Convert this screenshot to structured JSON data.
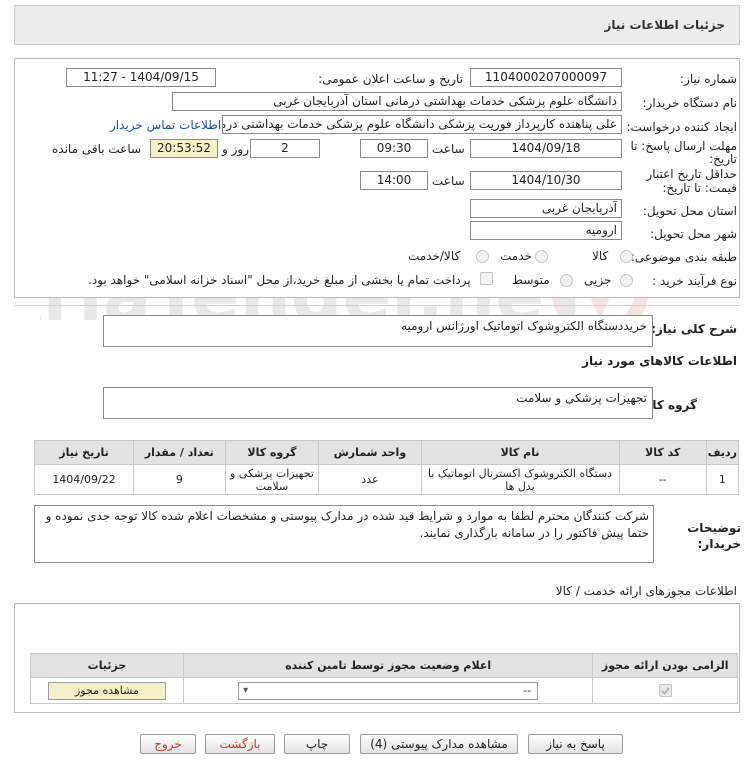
{
  "header": {
    "title": "جزئیات اطلاعات نیاز"
  },
  "fields": {
    "need_number_label": "شماره نیاز:",
    "need_number": "1104000207000097",
    "announce_label": "تاریخ و ساعت اعلان عمومی:",
    "announce_value": "1404/09/15 - 11:27",
    "buyer_org_label": "نام دستگاه خریدار:",
    "buyer_org": "دانشگاه علوم پزشکی خدمات بهداشتی درمانی استان آذربایجان غربی",
    "requester_label": "ایجاد کننده درخواست:",
    "requester": "علی پناهنده کارپرداز فوریت پزشکی دانشگاه علوم پزشکی خدمات بهداشتی درمانی استان آذربایجان غربی",
    "contact_link": "اطلاعات تماس خریدار",
    "deadline_label_1": "مهلت ارسال پاسخ: تا",
    "deadline_label_2": "تاریخ:",
    "deadline_date": "1404/09/18",
    "time_label": "ساعت",
    "deadline_time": "09:30",
    "days_value": "2",
    "days_label": "روز و",
    "remaining_time": "20:53:52",
    "remaining_label": "ساعت باقی مانده",
    "validity_label_1": "حداقل تاریخ اعتبار",
    "validity_label_2": "قیمت: تا تاریخ:",
    "validity_date": "1404/10/30",
    "validity_time": "14:00",
    "province_label": "استان محل تحویل:",
    "province": "آذربایجان غربی",
    "city_label": "شهر محل تحویل:",
    "city": "ارومیه",
    "category_label": "طبقه بندی موضوعی:",
    "category_options": [
      "کالا",
      "خدمت",
      "کالا/خدمت"
    ],
    "process_label": "نوع فرآیند خرید :",
    "process_options": [
      "جزیی",
      "متوسط"
    ],
    "payment_note": "پرداخت تمام یا بخشی از مبلغ خرید،از محل \"اسناد خزانه اسلامی\" خواهد بود."
  },
  "need_summary": {
    "label": "شرح کلی نیاز:",
    "value": "خریددستگاه الکتروشوک اتوماتیک اورژانس ارومیه"
  },
  "goods_section": {
    "title": "اطلاعات کالاهای مورد نیاز",
    "group_label": "گروه کالا:",
    "group_value": "تجهیزات پزشکی و سلامت",
    "columns": [
      "ردیف",
      "کد کالا",
      "نام کالا",
      "واحد شمارش",
      "گروه کالا",
      "تعداد / مقدار",
      "تاریخ نیاز"
    ],
    "rows": [
      [
        "1",
        "--",
        "دستگاه الکتروشوک اکسترنال اتوماتیک با پدل ها",
        "عدد",
        "تجهیزات پزشکی و سلامت",
        "9",
        "1404/09/22"
      ]
    ]
  },
  "buyer_notes": {
    "label": "توضیحات خریدار:",
    "value": "شرکت کنندگان محترم لطفا به موارد و شرایط قید شده در مدارک پیوستی و مشخصات اعلام شده کالا توجه جدی نموده و حتما پیش فاکتور را در سامانه بارگذاری نمایند."
  },
  "permits": {
    "title": "اطلاعات مجوزهای ارائه خدمت / کالا",
    "columns": [
      "الزامی بودن ارائه مجوز",
      "اعلام وضعیت مجوز توسط تامین کننده",
      "جزئیات"
    ],
    "select_value": "--",
    "view_button": "مشاهده مجوز"
  },
  "buttons": {
    "reply": "پاسخ به نیاز",
    "attachments": "مشاهده مدارک پیوستی (4)",
    "print": "چاپ",
    "back": "بازگشت",
    "exit": "خروج"
  },
  "colors": {
    "accent_link": "#1a4db3",
    "header_bg": "#ececec",
    "back_exit_text": "#c0392b",
    "remaining_bg": "#f6f0c8"
  },
  "watermark": "AriaTender.neT"
}
